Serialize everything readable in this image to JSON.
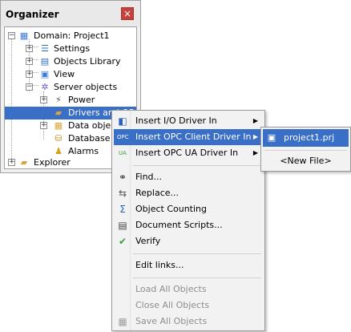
{
  "organizer": {
    "title": "Organizer",
    "close_glyph": "×",
    "tree": [
      {
        "label": "Domain: Project1",
        "icon": "domain-icon",
        "expander": "−"
      },
      {
        "label": "Settings",
        "icon": "settings-icon",
        "expander": "+"
      },
      {
        "label": "Objects Library",
        "icon": "library-icon",
        "expander": "+"
      },
      {
        "label": "View",
        "icon": "view-icon",
        "expander": "+"
      },
      {
        "label": "Server objects",
        "icon": "server-objects-icon",
        "expander": "−"
      },
      {
        "label": "Power",
        "icon": "power-icon",
        "expander": "+"
      },
      {
        "label": "Drivers and OPC",
        "icon": "drivers-folder-icon",
        "expander": ""
      },
      {
        "label": "Data objects",
        "icon": "data-objects-icon",
        "expander": "+"
      },
      {
        "label": "Database",
        "icon": "database-icon",
        "expander": ""
      },
      {
        "label": "Alarms",
        "icon": "alarms-icon",
        "expander": ""
      },
      {
        "label": "Explorer",
        "icon": "explorer-folder-icon",
        "expander": "+"
      }
    ]
  },
  "context_menu": {
    "items": [
      {
        "label": "Insert I/O Driver In",
        "icon": "io-driver-icon",
        "submenu": true
      },
      {
        "label": "Insert OPC Client Driver In",
        "icon": "opc-client-icon",
        "submenu": true
      },
      {
        "label": "Insert OPC UA Driver In",
        "icon": "opc-ua-icon",
        "submenu": true
      },
      {
        "label": "Find...",
        "icon": "binoculars-icon"
      },
      {
        "label": "Replace...",
        "icon": "replace-icon"
      },
      {
        "label": "Object Counting",
        "icon": "sigma-icon"
      },
      {
        "label": "Document Scripts...",
        "icon": "document-scripts-icon"
      },
      {
        "label": "Verify",
        "icon": "verify-icon"
      },
      {
        "label": "Edit links..."
      },
      {
        "label": "Load All Objects"
      },
      {
        "label": "Close All Objects"
      },
      {
        "label": "Save All Objects",
        "icon": "save-icon"
      }
    ],
    "arrow_glyph": "▶"
  },
  "submenu": {
    "items": [
      {
        "label": "project1.prj",
        "icon": "project-file-icon"
      },
      {
        "label": "<New File>"
      }
    ]
  },
  "colors": {
    "selection": "#3a6fc8",
    "disabled_text": "#8d8d8d"
  }
}
